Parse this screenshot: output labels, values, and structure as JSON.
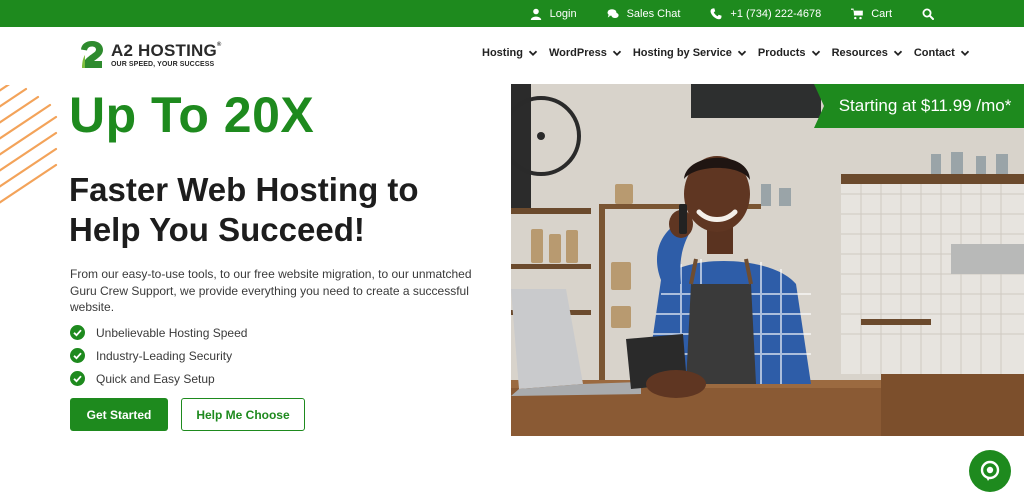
{
  "topbar": {
    "login": "Login",
    "sales_chat": "Sales Chat",
    "phone": "+1 (734) 222-4678",
    "cart": "Cart",
    "icons": [
      "user-icon",
      "chat-icon",
      "phone-icon",
      "cart-icon",
      "search-icon"
    ]
  },
  "logo": {
    "name": "A2 HOSTING",
    "registered": "®",
    "tagline": "OUR SPEED, YOUR SUCCESS"
  },
  "nav": {
    "items": [
      {
        "label": "Hosting"
      },
      {
        "label": "WordPress"
      },
      {
        "label": "Hosting by Service"
      },
      {
        "label": "Products"
      },
      {
        "label": "Resources"
      },
      {
        "label": "Contact"
      }
    ]
  },
  "hero": {
    "headline": "Up To 20X",
    "subheadline": "Faster Web Hosting to Help You Succeed!",
    "description": "From our easy-to-use tools, to our free website migration, to our unmatched Guru Crew Support, we provide everything you need to create a successful website.",
    "features": [
      "Unbelievable Hosting Speed",
      "Industry-Leading Security",
      "Quick and Easy Setup"
    ],
    "primary_button": "Get Started",
    "secondary_button": "Help Me Choose"
  },
  "promo": {
    "price_banner": "Starting at $11.99 /mo*"
  },
  "colors": {
    "brand_green": "#1e8a1e",
    "stripe_orange": "#f3a35a",
    "text_dark": "#1d1d1d"
  }
}
